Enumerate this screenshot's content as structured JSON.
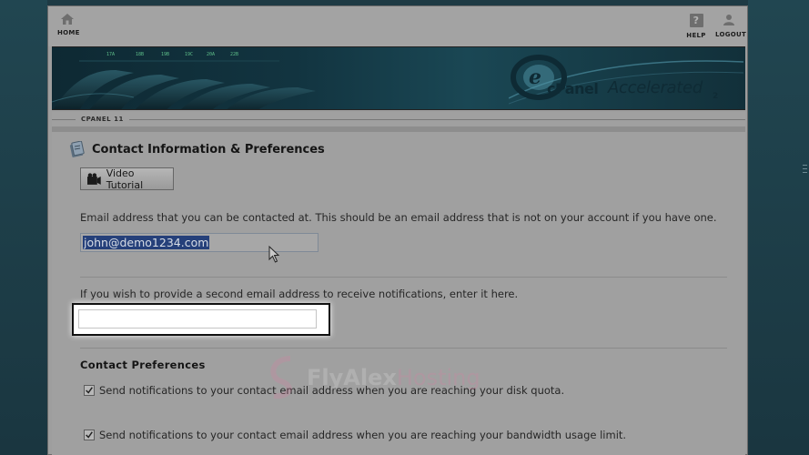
{
  "topbar": {
    "home_label": "HOME",
    "help_label": "HELP",
    "logout_label": "LOGOUT"
  },
  "banner": {
    "brand_cpanel": "cPanel",
    "brand_accelerated": "Accelerated",
    "brand_version": "2",
    "cable_labels": [
      "17A",
      "18B",
      "19B",
      "19C",
      "20A",
      "22B"
    ]
  },
  "breadcrumb": {
    "label": "CPANEL 11"
  },
  "main": {
    "title": "Contact Information & Preferences",
    "video_button_label": "Video Tutorial",
    "email_label": "Email address that you can be contacted at. This should be an email address that is not on your account if you have one.",
    "email_value": "john@demo1234.com",
    "second_email_label": "If you wish to provide a second email address to receive notifications, enter it here.",
    "second_email_value": "",
    "contact_prefs_title": "Contact Preferences",
    "prefs": [
      {
        "label": "Send notifications to your contact email address when you are reaching your disk quota.",
        "checked": true
      },
      {
        "label": "Send notifications to your contact email address when you are reaching your bandwidth usage limit.",
        "checked": true
      }
    ]
  },
  "watermark": {
    "text_a": "Fly",
    "text_b": "Alex",
    "text_c": "Hosting"
  },
  "colors": {
    "selection": "#25407a",
    "page_bg": "#a0a0a0",
    "outer_bg": "#1e3a44"
  }
}
